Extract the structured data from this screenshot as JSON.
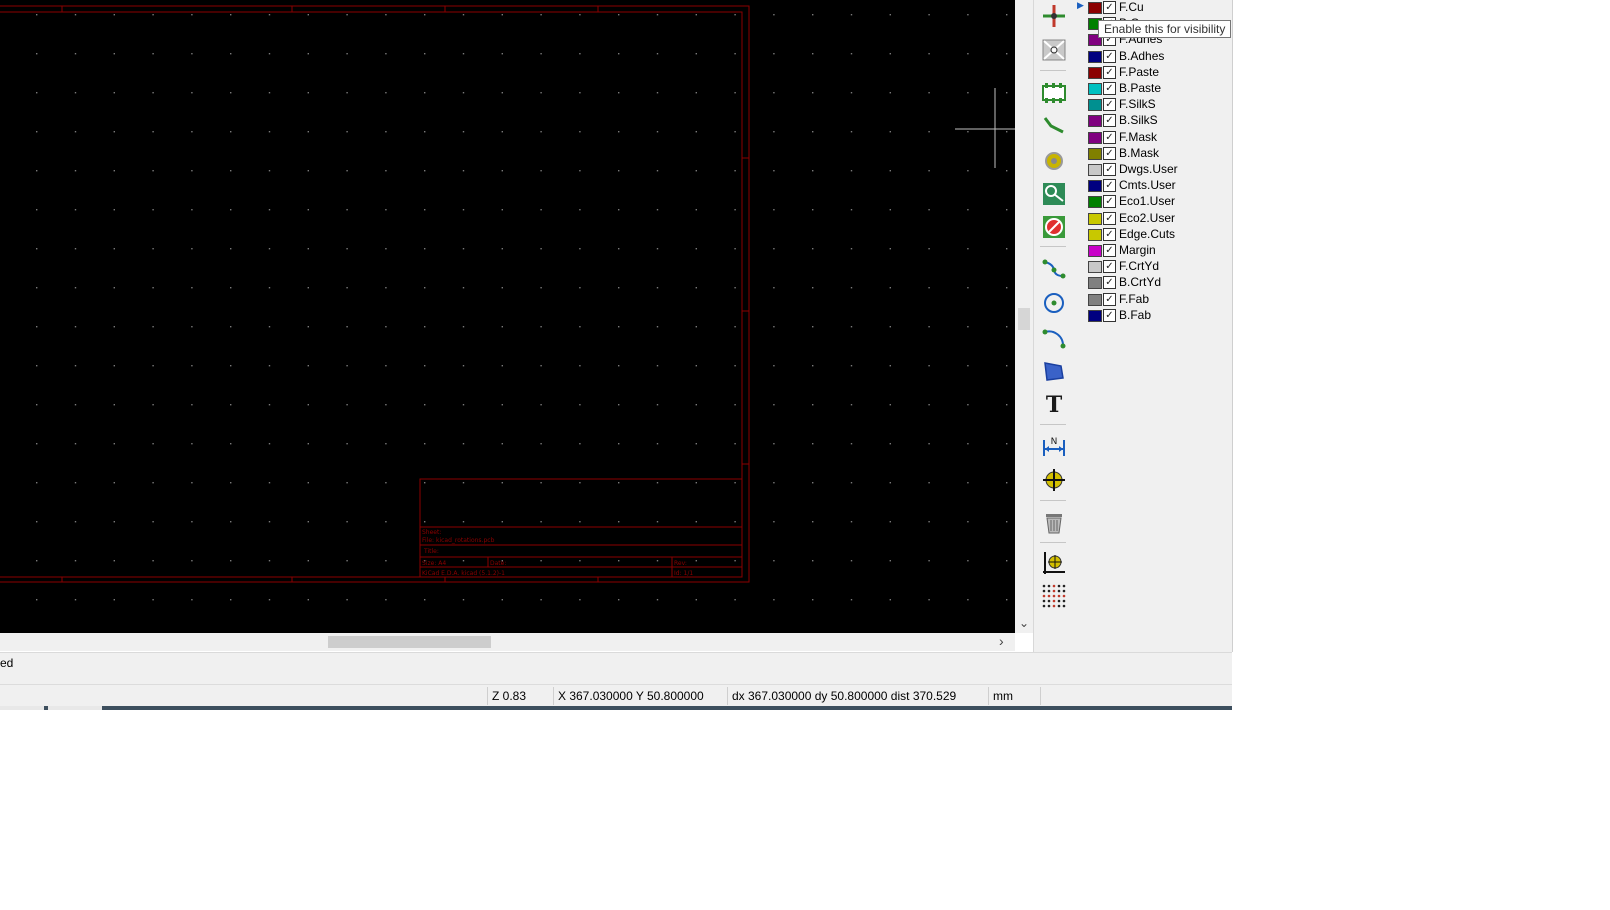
{
  "canvas": {
    "background": "#000000",
    "frame_color": "#8b0000",
    "grid_color": "#7a7a7a",
    "cursor_color": "#bfbfbf",
    "title_block": {
      "sheet": "Sheet:",
      "file": "File: kicad_rotations.pcb",
      "title": "Title:",
      "size": "Size: A4",
      "date": "Date:",
      "rev": "Rev:",
      "kicad": "KiCad E.D.A.  kicad (5.1.2)-1",
      "id": "Id: 1/1"
    }
  },
  "toolbar": {
    "tools": [
      {
        "name": "highlight-net-icon"
      },
      {
        "name": "local-ratsnest-icon"
      },
      {
        "name": "add-footprint-icon"
      },
      {
        "name": "route-track-icon"
      },
      {
        "name": "add-via-icon"
      },
      {
        "name": "add-zone-icon"
      },
      {
        "name": "add-keepout-icon"
      },
      {
        "name": "draw-line-icon"
      },
      {
        "name": "draw-circle-icon"
      },
      {
        "name": "draw-arc-icon"
      },
      {
        "name": "draw-polygon-icon"
      },
      {
        "name": "add-text-icon"
      },
      {
        "name": "add-dimension-icon"
      },
      {
        "name": "add-target-icon"
      },
      {
        "name": "delete-icon"
      },
      {
        "name": "set-origin-icon"
      },
      {
        "name": "grid-origin-icon"
      }
    ]
  },
  "layers": {
    "tooltip": "Enable this for visibility",
    "items": [
      {
        "name": "F.Cu",
        "color": "#8b0000",
        "checked": true
      },
      {
        "name": "B.Cu",
        "color": "#008000",
        "checked": true
      },
      {
        "name": "F.Adhes",
        "color": "#800080",
        "checked": true
      },
      {
        "name": "B.Adhes",
        "color": "#000080",
        "checked": true
      },
      {
        "name": "F.Paste",
        "color": "#8b0000",
        "checked": true
      },
      {
        "name": "B.Paste",
        "color": "#00c0c0",
        "checked": true
      },
      {
        "name": "F.SilkS",
        "color": "#009090",
        "checked": true
      },
      {
        "name": "B.SilkS",
        "color": "#800080",
        "checked": true
      },
      {
        "name": "F.Mask",
        "color": "#800080",
        "checked": true
      },
      {
        "name": "B.Mask",
        "color": "#808000",
        "checked": true
      },
      {
        "name": "Dwgs.User",
        "color": "#c8c8c8",
        "checked": true
      },
      {
        "name": "Cmts.User",
        "color": "#000080",
        "checked": true
      },
      {
        "name": "Eco1.User",
        "color": "#008000",
        "checked": true
      },
      {
        "name": "Eco2.User",
        "color": "#c8c800",
        "checked": true
      },
      {
        "name": "Edge.Cuts",
        "color": "#c8c800",
        "checked": true
      },
      {
        "name": "Margin",
        "color": "#c800c8",
        "checked": true
      },
      {
        "name": "F.CrtYd",
        "color": "#c8c8c8",
        "checked": true
      },
      {
        "name": "B.CrtYd",
        "color": "#808080",
        "checked": true
      },
      {
        "name": "F.Fab",
        "color": "#808080",
        "checked": true
      },
      {
        "name": "B.Fab",
        "color": "#000080",
        "checked": true
      }
    ]
  },
  "message": "ed",
  "status": {
    "zoom": "Z 0.83",
    "position": "X 367.030000  Y 50.800000",
    "delta": "dx 367.030000  dy 50.800000  dist 370.529",
    "units": "mm"
  }
}
